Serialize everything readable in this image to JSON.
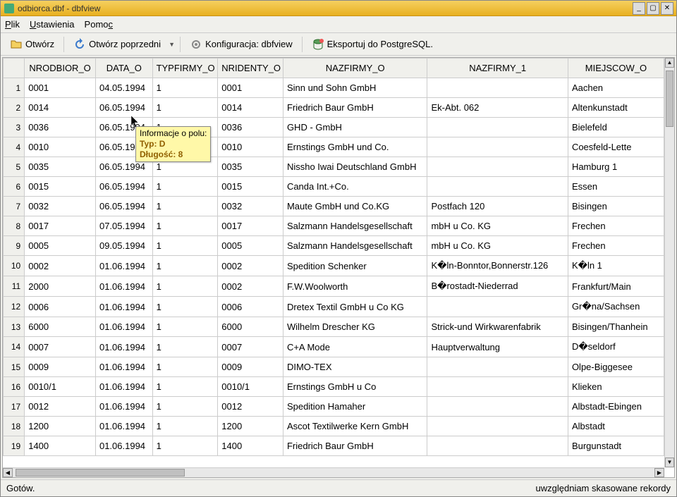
{
  "window": {
    "title": "odbiorca.dbf - dbfview"
  },
  "menu": {
    "items": [
      "Plik",
      "Ustawienia",
      "Pomoc"
    ]
  },
  "toolbar": {
    "open": "Otwórz",
    "open_prev": "Otwórz poprzedni",
    "config": "Konfiguracja: dbfview",
    "export": "Eksportuj do PostgreSQL."
  },
  "tooltip": {
    "line1": "Informacje o polu:",
    "line2": "Typ: D",
    "line3": "Długość: 8"
  },
  "table": {
    "headers": [
      "NRODBIOR_O",
      "DATA_O",
      "TYPFIRMY_O",
      "NRIDENTY_O",
      "NAZFIRMY_O",
      "NAZFIRMY_1",
      "MIEJSCOW_O"
    ],
    "rows": [
      {
        "n": 1,
        "c": [
          "0001",
          "04.05.1994",
          "1",
          "0001",
          "Sinn und Sohn GmbH",
          "",
          "Aachen"
        ]
      },
      {
        "n": 2,
        "c": [
          "0014",
          "06.05.1994",
          "1",
          "0014",
          "Friedrich Baur GmbH",
          "Ek-Abt. 062",
          "Altenkunstadt"
        ]
      },
      {
        "n": 3,
        "c": [
          "0036",
          "06.05.1994",
          "1",
          "0036",
          "GHD - GmbH",
          "",
          "Bielefeld"
        ]
      },
      {
        "n": 4,
        "c": [
          "0010",
          "06.05.1994",
          "1",
          "0010",
          "Ernstings GmbH und Co.",
          "",
          "Coesfeld-Lette"
        ]
      },
      {
        "n": 5,
        "c": [
          "0035",
          "06.05.1994",
          "1",
          "0035",
          "Nissho Iwai Deutschland GmbH",
          "",
          "Hamburg 1"
        ]
      },
      {
        "n": 6,
        "c": [
          "0015",
          "06.05.1994",
          "1",
          "0015",
          "Canda Int.+Co.",
          "",
          "Essen"
        ]
      },
      {
        "n": 7,
        "c": [
          "0032",
          "06.05.1994",
          "1",
          "0032",
          "Maute GmbH und Co.KG",
          "Postfach 120",
          "Bisingen"
        ]
      },
      {
        "n": 8,
        "c": [
          "0017",
          "07.05.1994",
          "1",
          "0017",
          "Salzmann Handelsgesellschaft",
          " mbH u Co. KG",
          "Frechen"
        ]
      },
      {
        "n": 9,
        "c": [
          "0005",
          "09.05.1994",
          "1",
          "0005",
          "Salzmann Handelsgesellschaft",
          " mbH u Co. KG",
          "Frechen"
        ]
      },
      {
        "n": 10,
        "c": [
          "0002",
          "01.06.1994",
          "1",
          "0002",
          "Spedition Schenker",
          "K�ln-Bonntor,Bonnerstr.126",
          "K�ln 1"
        ]
      },
      {
        "n": 11,
        "c": [
          "2000",
          "01.06.1994",
          "1",
          "0002",
          "F.W.Woolworth",
          "B�rostadt-Niederrad",
          "Frankfurt/Main"
        ]
      },
      {
        "n": 12,
        "c": [
          "0006",
          "01.06.1994",
          "1",
          "0006",
          "Dretex Textil GmbH u Co KG",
          "",
          "Gr�na/Sachsen"
        ]
      },
      {
        "n": 13,
        "c": [
          "6000",
          "01.06.1994",
          "1",
          "6000",
          "Wilhelm Drescher KG",
          "Strick-und Wirkwarenfabrik",
          "Bisingen/Thanhein"
        ]
      },
      {
        "n": 14,
        "c": [
          "0007",
          "01.06.1994",
          "1",
          "0007",
          "C+A Mode",
          "Hauptverwaltung",
          "D�seldorf"
        ]
      },
      {
        "n": 15,
        "c": [
          "0009",
          "01.06.1994",
          "1",
          "0009",
          "DIMO-TEX",
          "",
          "Olpe-Biggesee"
        ]
      },
      {
        "n": 16,
        "c": [
          "0010/1",
          "01.06.1994",
          "1",
          "0010/1",
          "Ernstings GmbH u Co",
          "",
          "Klieken"
        ]
      },
      {
        "n": 17,
        "c": [
          "0012",
          "01.06.1994",
          "1",
          "0012",
          "Spedition Hamaher",
          "",
          "Albstadt-Ebingen"
        ]
      },
      {
        "n": 18,
        "c": [
          "1200",
          "01.06.1994",
          "1",
          "1200",
          "Ascot Textilwerke Kern GmbH",
          "",
          "Albstadt"
        ]
      },
      {
        "n": 19,
        "c": [
          "1400",
          "01.06.1994",
          "1",
          "1400",
          "Friedrich Baur GmbH",
          "",
          "Burgunstadt"
        ]
      }
    ]
  },
  "status": {
    "left": "Gotów.",
    "right": "uwzględniam skasowane rekordy"
  }
}
